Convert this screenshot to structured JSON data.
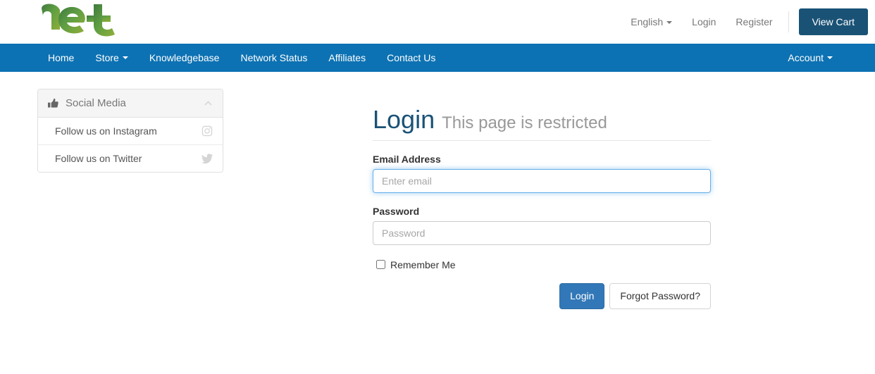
{
  "header": {
    "logo_alt": "net logo",
    "language": {
      "label": "English",
      "icon": "caret-down-icon"
    },
    "login_label": "Login",
    "register_label": "Register",
    "cart_label": "View Cart",
    "cart_color": "#1a5276"
  },
  "nav": {
    "background": "#0d72b3",
    "items": [
      {
        "label": "Home",
        "has_caret": false
      },
      {
        "label": "Store",
        "has_caret": true
      },
      {
        "label": "Knowledgebase",
        "has_caret": false
      },
      {
        "label": "Network Status",
        "has_caret": false
      },
      {
        "label": "Affiliates",
        "has_caret": false
      },
      {
        "label": "Contact Us",
        "has_caret": false
      }
    ],
    "account": {
      "label": "Account",
      "has_caret": true
    }
  },
  "sidebar": {
    "panel": {
      "title": "Social Media",
      "header_icon": "thumbs-up-icon",
      "collapse_icon": "chevron-up-icon",
      "rows": [
        {
          "label": "Follow us on Instagram",
          "icon": "instagram-icon"
        },
        {
          "label": "Follow us on Twitter",
          "icon": "twitter-icon"
        }
      ]
    }
  },
  "main": {
    "title": "Login",
    "subtitle": "This page is restricted",
    "title_color": "#1a5276",
    "email": {
      "label": "Email Address",
      "placeholder": "Enter email",
      "value": "",
      "focused": true
    },
    "password": {
      "label": "Password",
      "placeholder": "Password",
      "value": "",
      "focused": false
    },
    "remember": {
      "label": "Remember Me",
      "checked": false
    },
    "submit_label": "Login",
    "forgot_label": "Forgot Password?"
  }
}
